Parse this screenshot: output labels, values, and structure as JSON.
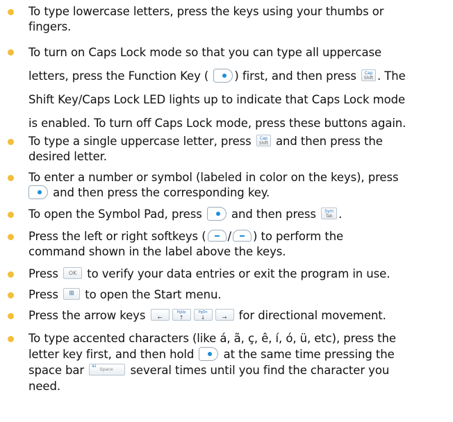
{
  "items": [
    {
      "l1": "To type lowercase letters, press the keys using your thumbs or",
      "l2": "fingers."
    },
    {
      "l1": "To turn on Caps Lock mode so that you can type all uppercase",
      "l2a": "letters, press the Function Key (",
      "l2b": ") first, and then press",
      "l2c": ". The",
      "l3": "Shift Key/Caps Lock LED lights up to indicate that Caps Lock mode",
      "l4": "is enabled. To turn off Caps Lock mode, press these buttons again."
    },
    {
      "l1a": "To type a single uppercase letter, press",
      "l1b": "and then press the",
      "l2": "desired letter."
    },
    {
      "l1": "To enter a number or symbol (labeled in color on the keys), press",
      "l2b": "and then press the corresponding key."
    },
    {
      "l1a": "To open the Symbol Pad, press",
      "l1b": "and then press",
      "l1c": "."
    },
    {
      "l1a": "Press the left or right softkeys (",
      "l1b": "/",
      "l1c": ") to perform the",
      "l2": "command shown in the label above the keys."
    },
    {
      "l1a": "Press",
      "l1b": "to verify your data entries or exit the program in use."
    },
    {
      "l1a": "Press",
      "l1b": "to open the Start menu."
    },
    {
      "l1a": "Press the arrow keys",
      "l1b": "for directional movement."
    },
    {
      "l1": "To type accented characters (like á, ã, ç, ê, í, ó, ü, etc), press the",
      "l2a": "letter key first, and then hold",
      "l2b": "at the same time pressing the",
      "l3a": "space bar",
      "l3b": "several times until you find the character you",
      "l4": "need."
    }
  ],
  "keys": {
    "cap_top": "Cap",
    "cap_bottom": "Shift",
    "sym_top": "Sym",
    "sym_bottom": "Tab",
    "ok": "OK",
    "start_glyph": "⊞",
    "pgup": "PgUp",
    "pgdn": "PgDn",
    "space": "Space",
    "space_top": "äü"
  },
  "bullet_color": "#f2bf3a",
  "function_key_dot_color": "#1c8fd6"
}
